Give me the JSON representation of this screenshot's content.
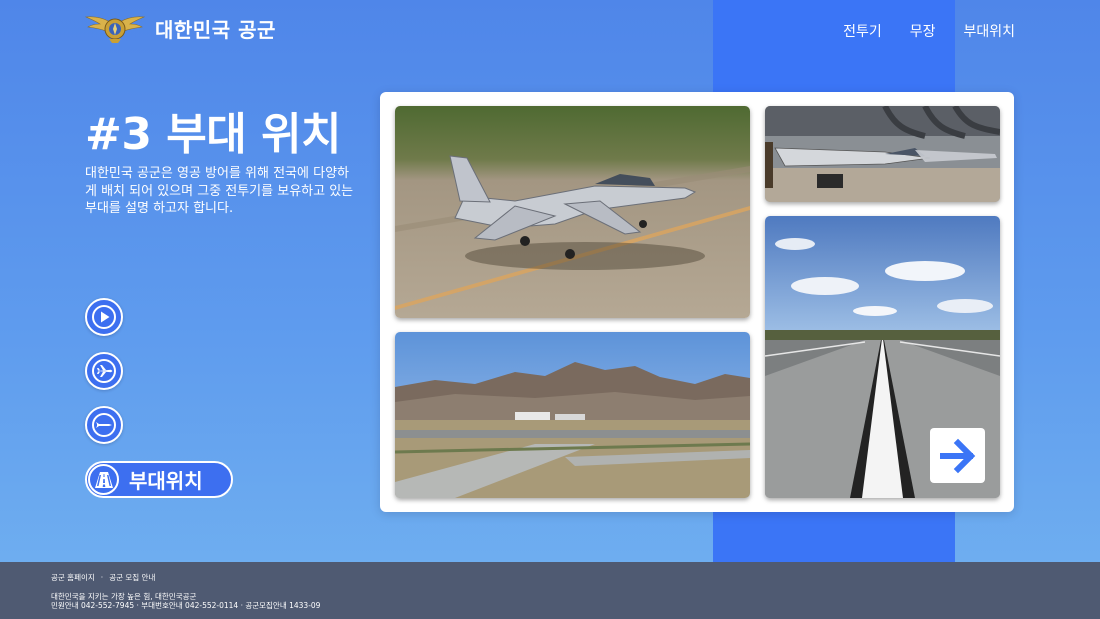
{
  "header": {
    "brand": "대한민국 공군",
    "nav": [
      "전투기",
      "무장",
      "부대위치"
    ]
  },
  "hero": {
    "title": "#3 부대 위치",
    "description": "대한민국 공군은 영공 방어를 위해 전국에 다양하게 배치 되어 있으며 그중 전투기를 보유하고 있는 부대를 설명 하고자 합니다."
  },
  "menu": {
    "icons": [
      "play-icon",
      "jet-icon",
      "missile-icon"
    ],
    "active": {
      "icon": "runway-icon",
      "label": "부대위치"
    }
  },
  "gallery": {
    "photos": [
      "trainer-jet-taxiing",
      "fighter-jets-in-shelters",
      "airbase-with-mountains",
      "runway-centerline"
    ],
    "next_icon": "arrow-right-icon"
  },
  "footer": {
    "links": [
      "공군 홈페이지",
      "공군 모집 안내"
    ],
    "separator": "·",
    "line1": "대한민국을 지키는 가장 높은 힘, 대한민국공군",
    "line2": "민원안내 042-552-7945 · 부대번호안내 042-552-0114 · 공군모집안내 1433-09"
  },
  "colors": {
    "accent": "#3b75f6",
    "button": "#3d6ff0",
    "footer": "#4f5a72"
  }
}
